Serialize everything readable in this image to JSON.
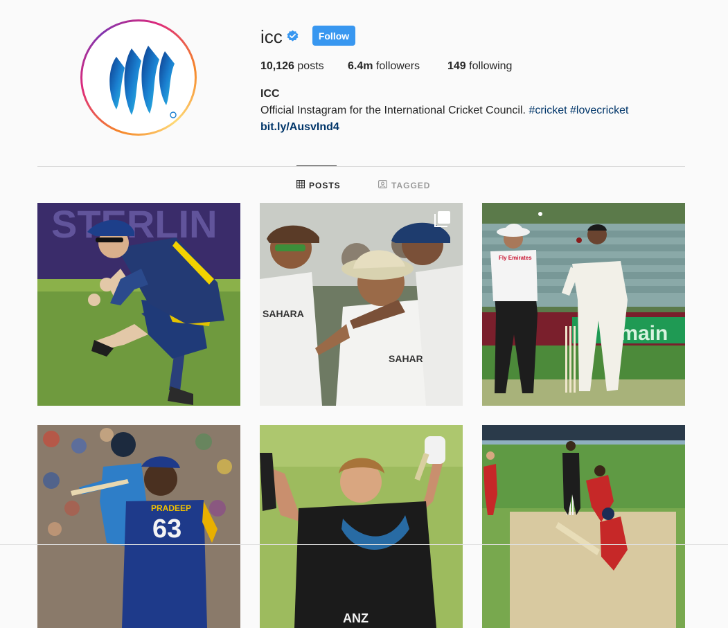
{
  "profile": {
    "username": "icc",
    "follow_label": "Follow",
    "posts_count": "10,126",
    "posts_label": "posts",
    "followers_count": "6.4m",
    "followers_label": "followers",
    "following_count": "149",
    "following_label": "following",
    "name": "ICC",
    "bio": "Official Instagram for the International Cricket Council.",
    "hashtags": [
      "#cricket",
      "#lovecricket"
    ],
    "link": "bit.ly/AusvInd4"
  },
  "tabs": [
    {
      "label": "POSTS",
      "active": true
    },
    {
      "label": "TAGGED",
      "active": false
    }
  ],
  "photo_texts": {
    "banner": "STERLIN",
    "umpire_shirt_brand": "Fly Emirates",
    "ad_board": "omain",
    "jersey_name": "PRADEEP",
    "jersey_number": "63",
    "sponsor_1": "SAHARA",
    "sponsor_2": "ANZ"
  },
  "colors": {
    "follow_blue": "#3897f0",
    "link_navy": "#003569",
    "verified_blue": "#3897f0"
  }
}
